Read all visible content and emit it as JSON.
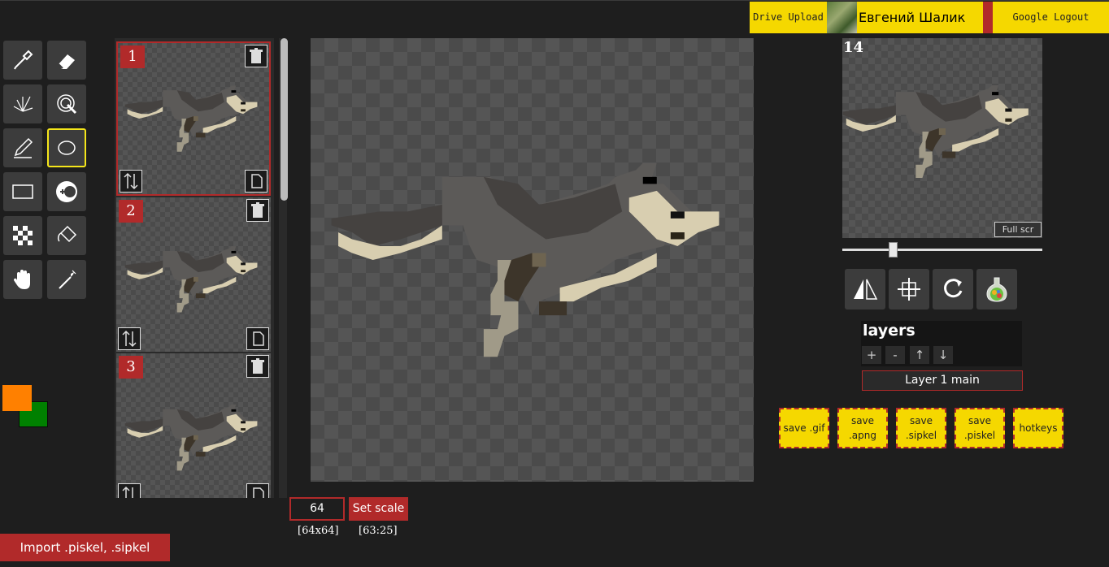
{
  "header": {
    "drive_upload": "Drive Upload",
    "user_name": "Евгений Шалик",
    "google_logout": "Google Logout"
  },
  "tools": [
    {
      "name": "eyedropper",
      "selected": false
    },
    {
      "name": "eraser",
      "selected": false
    },
    {
      "name": "spray-brush",
      "selected": false
    },
    {
      "name": "magic-lasso",
      "selected": false
    },
    {
      "name": "pencil",
      "selected": false
    },
    {
      "name": "ellipse",
      "selected": true
    },
    {
      "name": "rectangle",
      "selected": false
    },
    {
      "name": "color-swap",
      "selected": false
    },
    {
      "name": "dither",
      "selected": false
    },
    {
      "name": "bucket-fill",
      "selected": false
    },
    {
      "name": "hand",
      "selected": false
    },
    {
      "name": "magic-wand",
      "selected": false
    }
  ],
  "colors": {
    "primary": "#ff8000",
    "secondary": "#008000"
  },
  "frames": [
    {
      "number": "1",
      "active": true
    },
    {
      "number": "2",
      "active": false
    },
    {
      "number": "3",
      "active": false
    }
  ],
  "canvas": {
    "scale_value": "64",
    "set_scale_label": "Set scale",
    "size_info": "[64x64]",
    "cursor_info": "[63:25]"
  },
  "import_label": "Import .piskel, .sipkel",
  "preview": {
    "fps": "14",
    "fullscreen_label": "Full scr",
    "slider_fraction": 0.25
  },
  "actions": [
    "flip-icon",
    "center-icon",
    "rotate-icon",
    "flask-icon"
  ],
  "layers": {
    "title": "layers",
    "buttons": [
      "+",
      "-",
      "↑",
      "↓"
    ],
    "items": [
      "Layer 1 main"
    ]
  },
  "save_buttons": [
    "save .gif",
    "save\n.apng",
    "save\n.sipkel",
    "save\n.piskel",
    "hotkeys"
  ],
  "accent_colors": {
    "red": "#b12a2a",
    "yellow": "#f5d800"
  }
}
